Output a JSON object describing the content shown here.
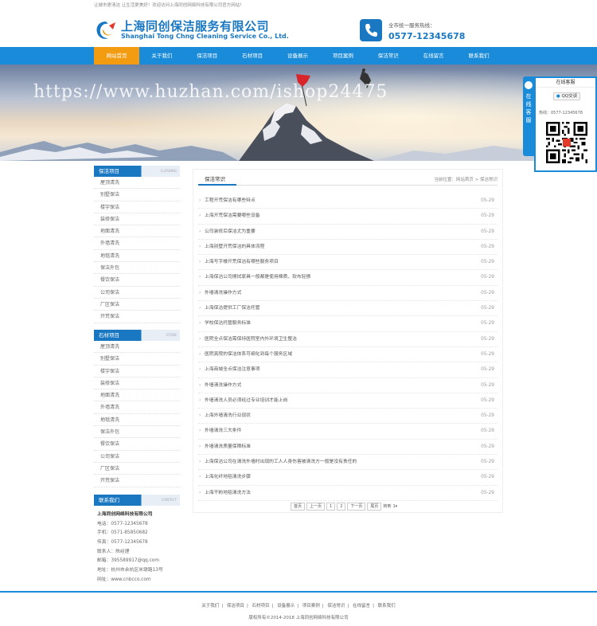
{
  "topbar": {
    "text": "让城市更清洁 让生活更美好！欢迎访问上海同创网络科技有限公司官方网站！"
  },
  "logo": {
    "cn": "上海同创保洁服务有限公司",
    "en": "Shanghai Tong Chng Cleaning Service Co., Ltd."
  },
  "hotline": {
    "label": "全市统一服务热线：",
    "number": "0577-12345678"
  },
  "nav": [
    "网站首页",
    "关于我们",
    "保洁项目",
    "石材项目",
    "设备展示",
    "项目案例",
    "保洁常识",
    "在线留言",
    "联系我们"
  ],
  "banner": {
    "watermark": "https://www.huzhan.com/ishop24475"
  },
  "side1": {
    "title": "保洁项目",
    "en": "CLEANING",
    "items": [
      "屋顶清洗",
      "别墅保洁",
      "楼宇保洁",
      "装修保洁",
      "地面清洗",
      "外墙清洗",
      "地毯清洗",
      "保洁外包",
      "餐饮保洁",
      "公司保洁",
      "厂区保洁",
      "开荒保洁"
    ]
  },
  "side2": {
    "title": "石材项目",
    "en": "STONE",
    "items": [
      "屋顶清洗",
      "别墅保洁",
      "楼宇保洁",
      "装修保洁",
      "地面清洗",
      "外墙清洗",
      "地毯清洗",
      "保洁外包",
      "餐饮保洁",
      "公司保洁",
      "厂区保洁",
      "开荒保洁"
    ]
  },
  "side3": {
    "title": "联系我们",
    "en": "CONTACT",
    "company": "上海同创网络科技有限公司",
    "lines": [
      "电话：0577-12345678",
      "手机：0571-85850682",
      "传真：0577-12345678",
      "联系人：陈经理",
      "邮箱：395589917@qq.com",
      "地址：杭州市余杭区米墩路13号",
      "网址：www.cnbcco.com"
    ]
  },
  "main": {
    "title": "保洁常识",
    "crumb": "当前位置：网站首页 > 保洁常识"
  },
  "news": [
    {
      "t": "工程开荒保洁有哪些特点",
      "d": "05-29"
    },
    {
      "t": "上海开荒保洁需要哪些设备",
      "d": "05-29"
    },
    {
      "t": "公司装修后保洁尤为重要",
      "d": "05-29"
    },
    {
      "t": "上海别墅开荒保洁的具体流程",
      "d": "05-29"
    },
    {
      "t": "上海写字楼开荒保洁有哪些服务项目",
      "d": "05-29"
    },
    {
      "t": "上海保洁公司擦拭家具一般都是使用棉质、软布轻擦",
      "d": "05-29"
    },
    {
      "t": "外墙清洗操作方式",
      "d": "05-29"
    },
    {
      "t": "上海保洁提供工厂保洁托管",
      "d": "05-29"
    },
    {
      "t": "学校保洁托管服务标准",
      "d": "05-29"
    },
    {
      "t": "医院全点保洁需保持医院室内外环境卫生整洁",
      "d": "05-29"
    },
    {
      "t": "医院真院的保洁体系可细化到每个服务区域",
      "d": "05-29"
    },
    {
      "t": "上海商城全点保洁注意事项",
      "d": "05-29"
    },
    {
      "t": "外墙清洗操作方式",
      "d": "05-29"
    },
    {
      "t": "外墙清洗人员必须经过专业培训才能上岗",
      "d": "05-29"
    },
    {
      "t": "上海外墙清洗行业现状",
      "d": "05-29"
    },
    {
      "t": "外墙清洗三大条件",
      "d": "05-29"
    },
    {
      "t": "外墙清洗质量保障标准",
      "d": "05-29"
    },
    {
      "t": "上海保洁公司在清洗外墙时出现的工人人身伤害被清洗方一般是没有责任的",
      "d": "05-29"
    },
    {
      "t": "上海化纤地毯清洗步骤",
      "d": "05-29"
    },
    {
      "t": "上海干粉地毯清洗方法",
      "d": "05-29"
    }
  ],
  "pager": {
    "first": "首页",
    "prev": "上一页",
    "p1": "1",
    "p2": "2",
    "next": "下一页",
    "last": "尾页",
    "jump": "转到",
    "select": "1"
  },
  "float": {
    "tab": "在线客服",
    "title": "在线客服",
    "qq": "QQ交谈",
    "hot": "热线：0577-12345678"
  },
  "footer": {
    "links": [
      "关于我们",
      "保洁项目",
      "石材项目",
      "设备展示",
      "项目案例",
      "保洁常识",
      "在线留言",
      "联系我们"
    ],
    "copy": "版权所有©2014-2018 上海同创网络科技有限公司"
  },
  "colors": {
    "primary": "#1a8bd8",
    "accent": "#f39c12"
  }
}
